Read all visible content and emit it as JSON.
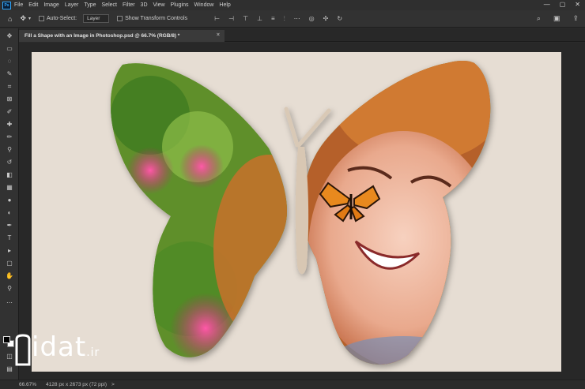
{
  "app": {
    "logo": "Ps"
  },
  "menu": [
    "File",
    "Edit",
    "Image",
    "Layer",
    "Type",
    "Select",
    "Filter",
    "3D",
    "View",
    "Plugins",
    "Window",
    "Help"
  ],
  "window_controls": {
    "minimize": "—",
    "maximize": "▢",
    "close": "✕"
  },
  "options": {
    "auto_select_label": "Auto-Select:",
    "auto_select_value": "Layer",
    "transform_label": "Show Transform Controls"
  },
  "document": {
    "tab_title": "Fill a Shape with an Image in Photoshop.psd @ 66.7% (RGB/8) *",
    "tab_close": "×"
  },
  "status": {
    "zoom": "66.67%",
    "doc_info": "4128 px x 2673 px (72 ppi)",
    "arrow": ">"
  },
  "watermark": {
    "text": "idat",
    "domain": ".ir"
  },
  "colors": {
    "canvas_bg": "#e6ddd3",
    "ui_dark": "#2b2b2b",
    "accent": "#31a8ff"
  },
  "icons": {
    "home": "home-icon",
    "move": "move-icon",
    "foreground": "foreground-color-swatch",
    "background": "background-color-swatch"
  }
}
